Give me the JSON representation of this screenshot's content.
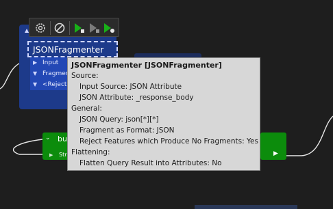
{
  "canvas": {
    "transformer": {
      "name": "JSONFragmenter",
      "ports": [
        {
          "label": "Input"
        },
        {
          "label": "Fragment"
        },
        {
          "label": "<Rejected>"
        }
      ]
    },
    "green_transformer": {
      "title": "bu",
      "port_label": "Str"
    }
  },
  "toolbar": {
    "buttons": [
      {
        "icon": "gear-icon"
      },
      {
        "icon": "disable-icon"
      },
      {
        "icon": "run-to-this-icon"
      },
      {
        "icon": "run-from-this-icon"
      },
      {
        "icon": "run-partial-icon"
      }
    ]
  },
  "tooltip": {
    "title": "JSONFragmenter [JSONFragmenter]",
    "sections": [
      {
        "heading": "Source:",
        "items": [
          "Input Source: JSON Attribute",
          "JSON Attribute: _response_body"
        ]
      },
      {
        "heading": "General:",
        "items": [
          "JSON Query: json[*][*]",
          "Fragment as Format: JSON",
          "Reject Features which Produce No Fragments: Yes"
        ]
      },
      {
        "heading": "Flattening:",
        "items": [
          "Flatten Query Result into Attributes: No"
        ]
      }
    ]
  },
  "colors": {
    "canvas_bg": "#1e1e1e",
    "transformer_blue": "#1d3a8a",
    "transformer_green": "#0c8c0c",
    "tooltip_bg": "#d7d7d7"
  }
}
